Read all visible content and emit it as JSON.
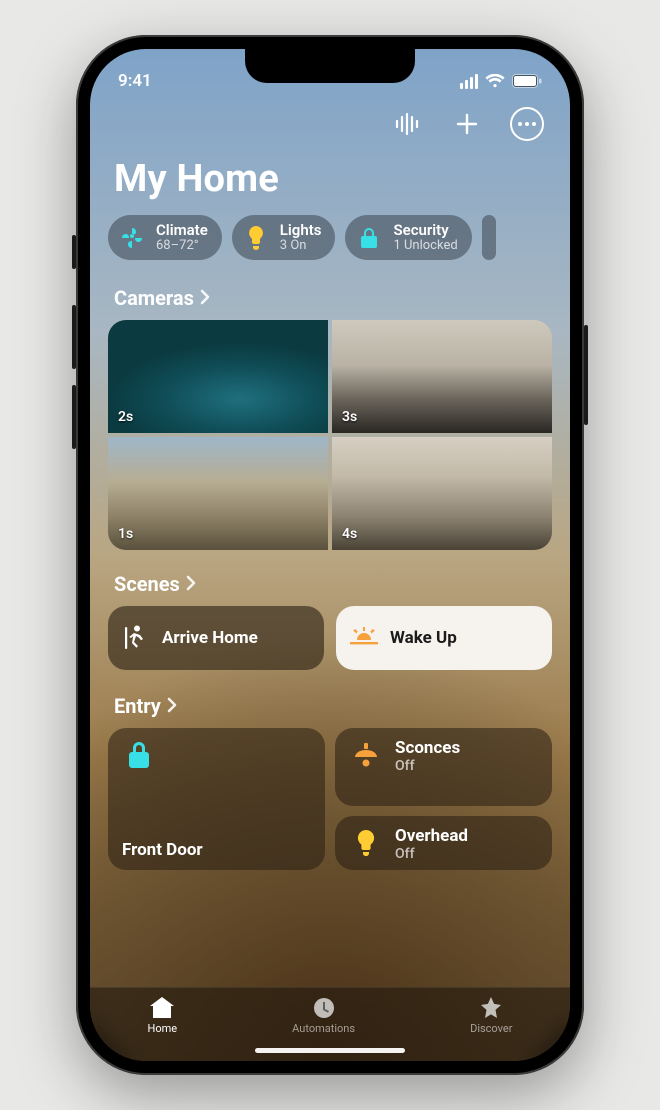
{
  "status": {
    "time": "9:41"
  },
  "header": {
    "title": "My Home"
  },
  "summary": {
    "climate": {
      "label": "Climate",
      "value": "68–72°"
    },
    "lights": {
      "label": "Lights",
      "value": "3 On"
    },
    "security": {
      "label": "Security",
      "value": "1 Unlocked"
    }
  },
  "cameras": {
    "heading": "Cameras",
    "tiles": [
      {
        "timestamp": "2s"
      },
      {
        "timestamp": "3s"
      },
      {
        "timestamp": "1s"
      },
      {
        "timestamp": "4s"
      }
    ]
  },
  "scenes": {
    "heading": "Scenes",
    "items": [
      {
        "label": "Arrive Home"
      },
      {
        "label": "Wake Up"
      }
    ]
  },
  "entry": {
    "heading": "Entry",
    "front_door": {
      "name": "Front Door"
    },
    "sconces": {
      "name": "Sconces",
      "state": "Off"
    },
    "overhead": {
      "name": "Overhead",
      "state": "Off"
    }
  },
  "tabs": {
    "home": "Home",
    "automations": "Automations",
    "discover": "Discover"
  }
}
